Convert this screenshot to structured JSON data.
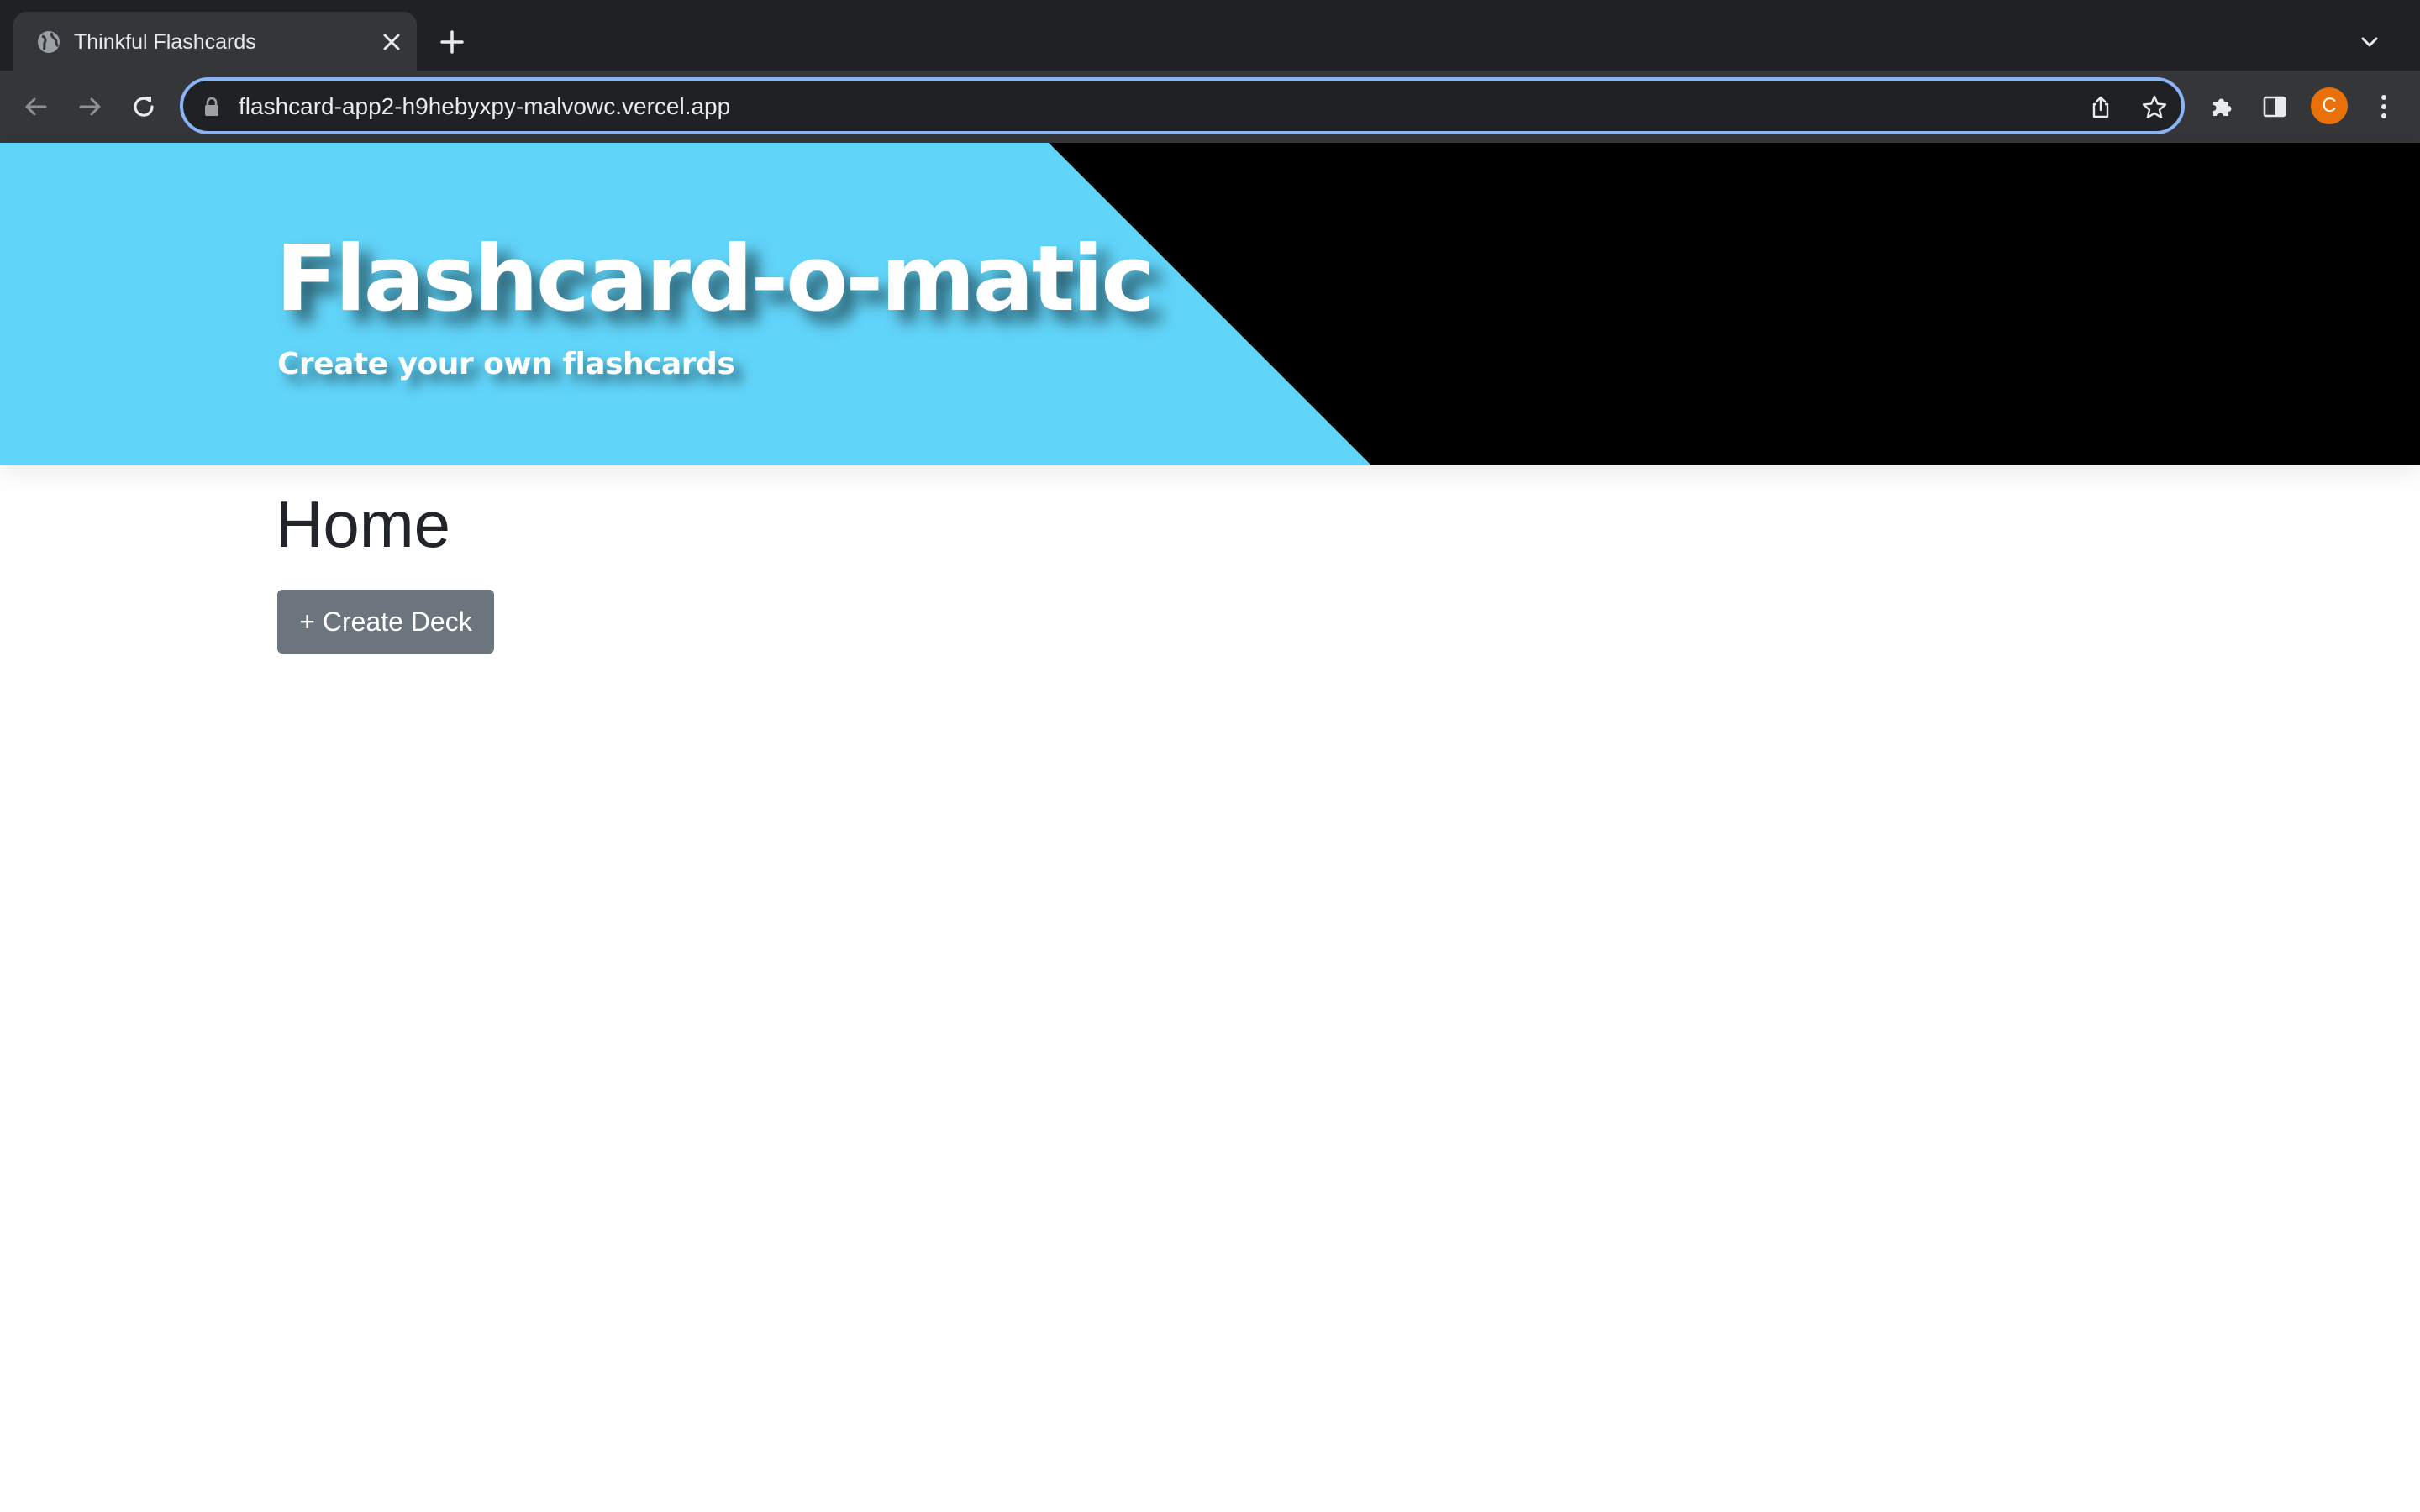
{
  "browser": {
    "tab": {
      "title": "Thinkful Flashcards",
      "favicon_icon": "globe-icon",
      "close_icon": "close-icon"
    },
    "new_tab_icon": "plus-icon",
    "tab_search_icon": "chevron-down-icon",
    "toolbar": {
      "back_icon": "arrow-left-icon",
      "forward_icon": "arrow-right-icon",
      "reload_icon": "reload-icon",
      "lock_icon": "lock-icon",
      "url": "flashcard-app2-h9hebyxpy-malvowc.vercel.app",
      "share_icon": "share-icon",
      "bookmark_icon": "star-icon",
      "extensions_icon": "puzzle-icon",
      "side_panel_icon": "side-panel-icon",
      "profile_initial": "C",
      "menu_icon": "kebab-menu-icon"
    },
    "colors": {
      "tabstrip": "#202124",
      "toolbar": "#35363a",
      "omnibox_focus": "#8ab4f8",
      "profile": "#e8710a"
    }
  },
  "header": {
    "title": "Flashcard-o-matic",
    "subtitle": "Create your own flashcards",
    "colors": {
      "accent": "#61d4f9",
      "dark": "#000000"
    }
  },
  "main": {
    "heading": "Home",
    "create_deck_label": "+ Create Deck",
    "colors": {
      "button": "#6c757d",
      "heading": "#212529"
    }
  }
}
